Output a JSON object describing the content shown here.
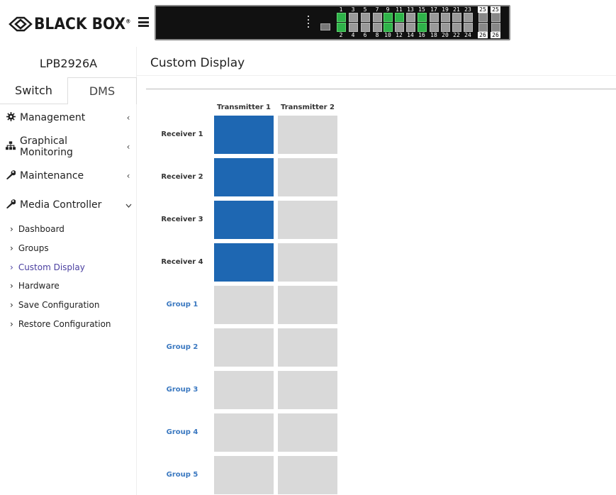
{
  "header": {
    "brand_text": "BLACK BOX",
    "brand_tm": "®",
    "port_labels_top": [
      "1",
      "3",
      "5",
      "7",
      "9",
      "11",
      "13",
      "15",
      "17",
      "19",
      "21",
      "23",
      "25",
      "25"
    ],
    "port_labels_bottom": [
      "2",
      "4",
      "6",
      "8",
      "10",
      "12",
      "14",
      "16",
      "18",
      "20",
      "22",
      "24",
      "26",
      "26"
    ],
    "active_ports": [
      "1",
      "2",
      "9",
      "10",
      "11",
      "15",
      "16"
    ]
  },
  "sidebar": {
    "device_name": "LPB2926A",
    "tabs": [
      {
        "label": "Switch"
      },
      {
        "label": "DMS"
      }
    ],
    "menu": [
      {
        "label": "Management",
        "icon": "gear-icon",
        "glyph": "✿",
        "arrow": "‹"
      },
      {
        "label": "Graphical Monitoring",
        "icon": "sitemap-icon",
        "glyph": "♣",
        "arrow": "‹"
      },
      {
        "label": "Maintenance",
        "icon": "wrench-icon",
        "glyph": "🔧",
        "arrow": "‹"
      },
      {
        "label": "Media Controller",
        "icon": "wrench-icon",
        "glyph": "🔧",
        "arrow": "⌄"
      }
    ],
    "submenu": [
      {
        "label": "Dashboard"
      },
      {
        "label": "Groups"
      },
      {
        "label": "Custom Display"
      },
      {
        "label": "Hardware"
      },
      {
        "label": "Save Configuration"
      },
      {
        "label": "Restore Configuration"
      }
    ],
    "chevron": "›"
  },
  "main": {
    "title": "Custom Display",
    "columns": [
      "Transmitter 1",
      "Transmitter 2"
    ],
    "rows": [
      {
        "label": "Receiver 1",
        "kind": "recv",
        "cells": [
          true,
          false
        ]
      },
      {
        "label": "Receiver 2",
        "kind": "recv",
        "cells": [
          true,
          false
        ]
      },
      {
        "label": "Receiver 3",
        "kind": "recv",
        "cells": [
          true,
          false
        ]
      },
      {
        "label": "Receiver 4",
        "kind": "recv",
        "cells": [
          true,
          false
        ]
      },
      {
        "label": "Group 1",
        "kind": "grp",
        "cells": [
          false,
          false
        ]
      },
      {
        "label": "Group 2",
        "kind": "grp",
        "cells": [
          false,
          false
        ]
      },
      {
        "label": "Group 3",
        "kind": "grp",
        "cells": [
          false,
          false
        ]
      },
      {
        "label": "Group 4",
        "kind": "grp",
        "cells": [
          false,
          false
        ]
      },
      {
        "label": "Group 5",
        "kind": "grp",
        "cells": [
          false,
          false
        ]
      }
    ]
  },
  "colors": {
    "assigned": "#1e67b2",
    "unassigned": "#d9d9d9",
    "group_label": "#3a78c0",
    "active_link": "#4a3fa0",
    "port_active": "#2fb34a"
  }
}
